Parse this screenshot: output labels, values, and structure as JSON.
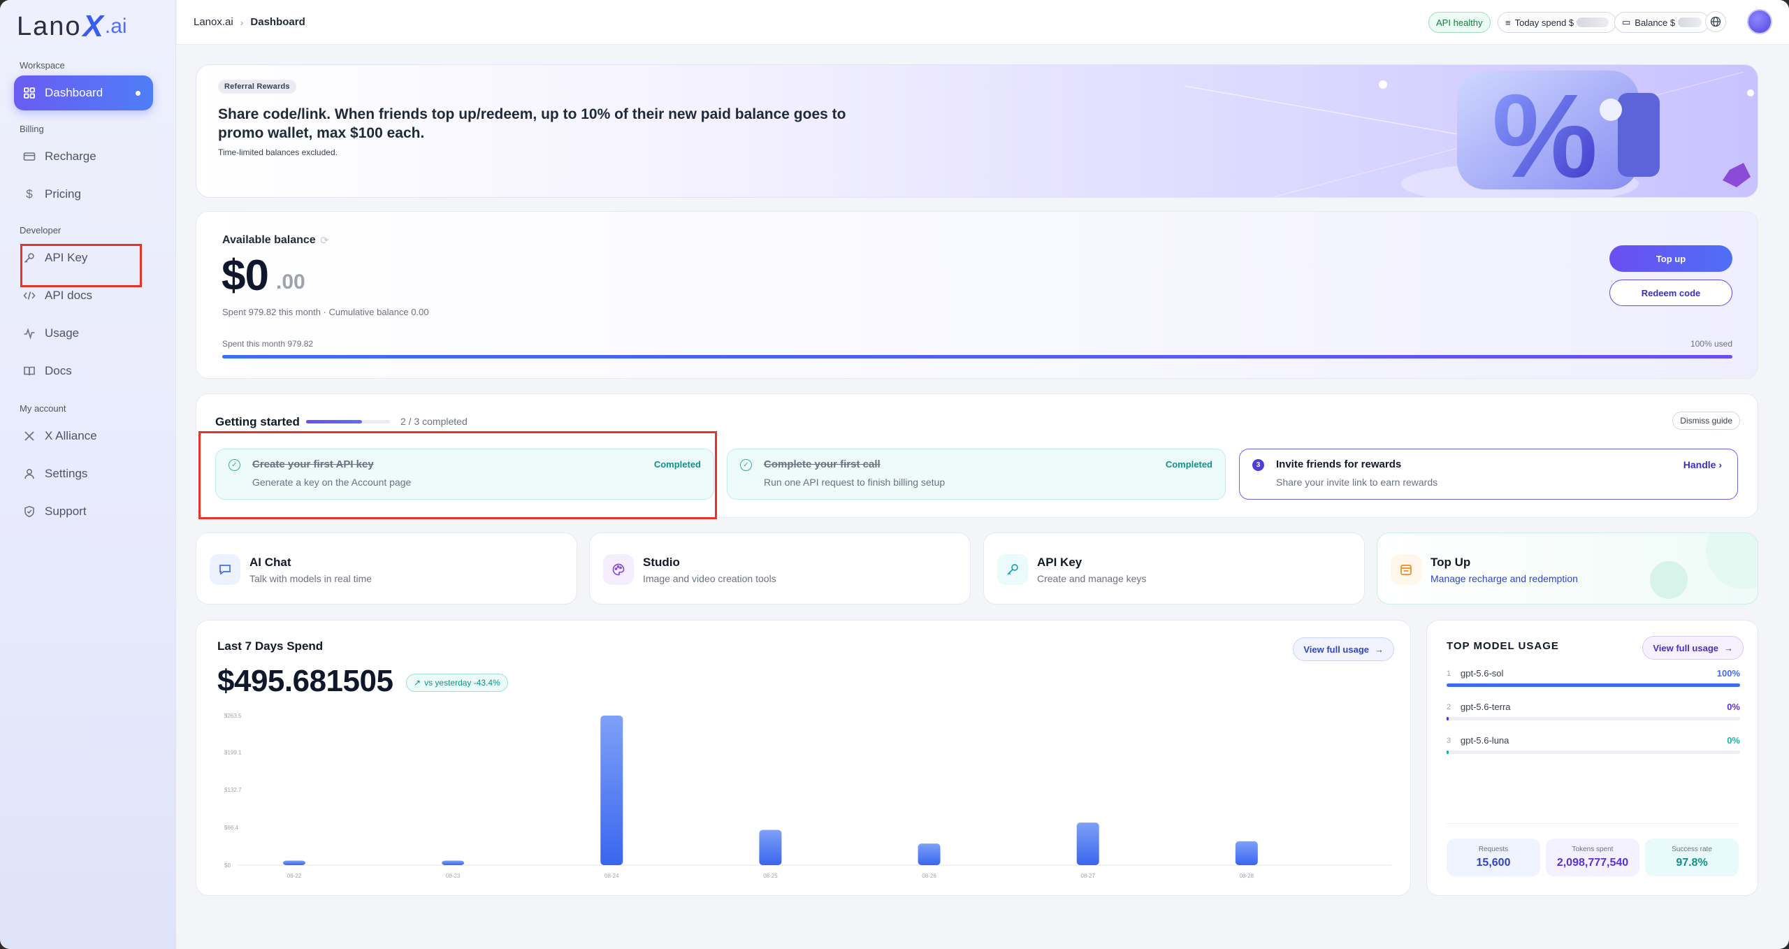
{
  "logo": {
    "pre": "Lano",
    "x": "X",
    "ai": ".ai"
  },
  "sidebar": {
    "sections": {
      "workspace": "Workspace",
      "billing": "Billing",
      "developer": "Developer",
      "account": "My account"
    },
    "items": [
      {
        "label": "Dashboard",
        "icon": "grid-icon"
      },
      {
        "label": "Recharge",
        "icon": "card-icon"
      },
      {
        "label": "Pricing",
        "icon": "dollar-icon"
      },
      {
        "label": "API Key",
        "icon": "key-icon"
      },
      {
        "label": "API docs",
        "icon": "code-icon"
      },
      {
        "label": "Usage",
        "icon": "activity-icon"
      },
      {
        "label": "Docs",
        "icon": "book-icon"
      },
      {
        "label": "X Alliance",
        "icon": "x-icon"
      },
      {
        "label": "Settings",
        "icon": "user-icon"
      },
      {
        "label": "Support",
        "icon": "shield-icon"
      }
    ]
  },
  "topbar": {
    "crumb_root": "Lanox.ai",
    "crumb_current": "Dashboard",
    "api_status": "API healthy",
    "today_spend": "Today spend $",
    "balance": "Balance $"
  },
  "banner": {
    "tag": "Referral Rewards",
    "title": "Share code/link. When friends top up/redeem, up to 10% of their new paid balance goes to promo wallet, max $100 each.",
    "subtitle": "Time-limited balances excluded."
  },
  "balance": {
    "label": "Available balance",
    "amount": "$0",
    "cents": ".00",
    "meta": "Spent 979.82 this month · Cumulative balance 0.00",
    "spent_label": "Spent this month 979.82",
    "used_label": "100% used",
    "used_fraction": 1.0,
    "top_up": "Top up",
    "redeem": "Redeem code"
  },
  "getting_started": {
    "title": "Getting started",
    "count": "2 / 3 completed",
    "progress": 0.667,
    "dismiss": "Dismiss guide",
    "steps": [
      {
        "title": "Create your first API key",
        "desc": "Generate a key on the Account page",
        "status": "Completed"
      },
      {
        "title": "Complete your first call",
        "desc": "Run one API request to finish billing setup",
        "status": "Completed"
      },
      {
        "num": "3",
        "title": "Invite friends for rewards",
        "desc": "Share your invite link to earn rewards",
        "status": "Handle"
      }
    ]
  },
  "quick_cards": [
    {
      "title": "AI Chat",
      "desc": "Talk with models in real time",
      "icon": "chat-icon"
    },
    {
      "title": "Studio",
      "desc": "Image and video creation tools",
      "icon": "palette-icon"
    },
    {
      "title": "API Key",
      "desc": "Create and manage keys",
      "icon": "key-icon"
    },
    {
      "title": "Top Up",
      "desc": "Manage recharge and redemption",
      "icon": "wallet-icon"
    }
  ],
  "spend": {
    "title": "Last 7 Days Spend",
    "total": "$495.681505",
    "delta": "vs yesterday -43.4%",
    "view_full": "View full usage"
  },
  "chart_data": {
    "type": "bar",
    "categories": [
      "08-22",
      "08-23",
      "08-24",
      "08-25",
      "08-26",
      "08-27",
      "08-28"
    ],
    "values": [
      8,
      8,
      263.5,
      62,
      38,
      75,
      42
    ],
    "ylim": [
      0,
      263.5
    ],
    "yticks": [
      "$0",
      "$66.4",
      "$132.7",
      "$199.1",
      "$263.5"
    ],
    "ytick_values": [
      0,
      66.4,
      132.7,
      199.1,
      263.5
    ],
    "xlabel": "",
    "ylabel": "",
    "title": "Last 7 Days Spend"
  },
  "top_model_usage": {
    "title": "TOP MODEL USAGE",
    "view_full": "View full usage",
    "models": [
      {
        "rank": "1",
        "name": "gpt-5.6-sol",
        "pct": "100%",
        "share": 1.0,
        "color": "#3b6ef0"
      },
      {
        "rank": "2",
        "name": "gpt-5.6-terra",
        "pct": "0%",
        "share": 0.0,
        "color": "#5b2fd8"
      },
      {
        "rank": "3",
        "name": "gpt-5.6-luna",
        "pct": "0%",
        "share": 0.0,
        "color": "#18b3a8"
      }
    ],
    "stats": [
      {
        "label": "Requests",
        "value": "15,600",
        "color": "#2f45c2"
      },
      {
        "label": "Tokens spent",
        "value": "2,098,777,540",
        "color": "#5b2fd8"
      },
      {
        "label": "Success rate",
        "value": "97.8%",
        "color": "#128f88"
      }
    ]
  }
}
